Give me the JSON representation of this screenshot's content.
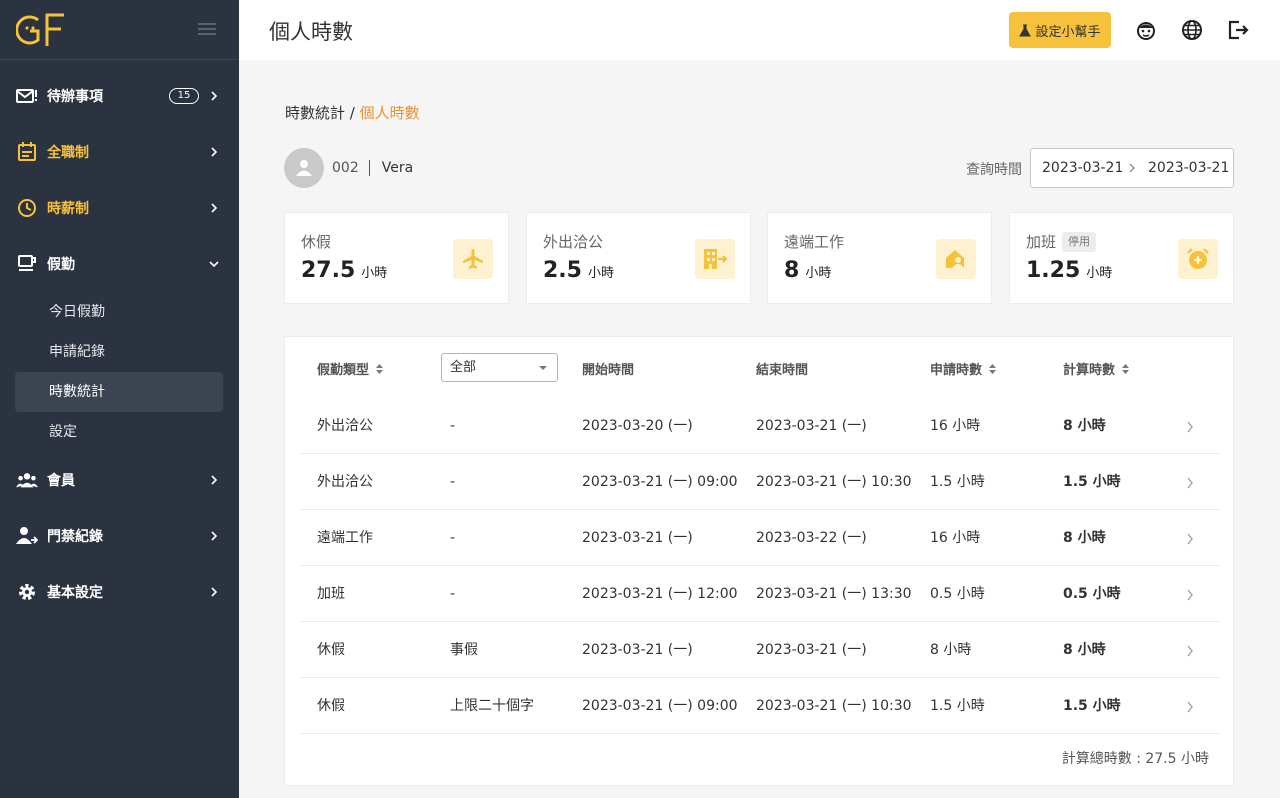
{
  "colors": {
    "accent": "#f6c13b",
    "sidebar_bg": "#2b3240",
    "breadcrumb_current": "#f08f2b",
    "icon_bg": "#fdf1cf"
  },
  "sidebar": {
    "logo_icon": "gf-logo-icon",
    "menu_icon": "hamburger-icon",
    "items": [
      {
        "label": "待辦事項",
        "icon": "mail-alert-icon",
        "badge": "15"
      },
      {
        "label": "全職制",
        "icon": "calendar-icon"
      },
      {
        "label": "時薪制",
        "icon": "clock-icon"
      },
      {
        "label": "假勤",
        "icon": "coffee-icon"
      },
      {
        "label": "會員",
        "icon": "users-icon"
      },
      {
        "label": "門禁紀錄",
        "icon": "user-access-icon"
      },
      {
        "label": "基本設定",
        "icon": "gear-icon"
      }
    ],
    "sub_items": [
      {
        "label": "今日假勤"
      },
      {
        "label": "申請紀錄"
      },
      {
        "label": "時數統計"
      },
      {
        "label": "設定"
      }
    ]
  },
  "header": {
    "title": "個人時數",
    "helper_button": "設定小幫手",
    "icons": [
      "emoji-icon",
      "globe-icon",
      "logout-icon"
    ]
  },
  "breadcrumb": {
    "parent": "時數統計",
    "separator": "/",
    "current": "個人時數"
  },
  "user": {
    "id": "002",
    "name": "Vera"
  },
  "query": {
    "label": "查詢時間",
    "start": "2023-03-21",
    "end": "2023-03-21"
  },
  "stats": [
    {
      "title": "休假",
      "value": "27.5",
      "unit": "小時",
      "icon": "airplane-icon"
    },
    {
      "title": "外出洽公",
      "value": "2.5",
      "unit": "小時",
      "icon": "building-exit-icon"
    },
    {
      "title": "遠端工作",
      "value": "8",
      "unit": "小時",
      "icon": "home-work-icon"
    },
    {
      "title": "加班",
      "tag": "停用",
      "value": "1.25",
      "unit": "小時",
      "icon": "alarm-plus-icon"
    }
  ],
  "table": {
    "headers": {
      "type": "假勤類型",
      "filter": "全部",
      "start": "開始時間",
      "end": "結束時間",
      "applied": "申請時數",
      "calculated": "計算時數"
    },
    "rows": [
      {
        "type": "外出洽公",
        "sub": "-",
        "start": "2023-03-20 (一)",
        "end": "2023-03-21 (一)",
        "applied": "16 小時",
        "calculated": "8 小時"
      },
      {
        "type": "外出洽公",
        "sub": "-",
        "start": "2023-03-21 (一)  09:00",
        "end": "2023-03-21 (一)  10:30",
        "applied": "1.5 小時",
        "calculated": "1.5 小時"
      },
      {
        "type": "遠端工作",
        "sub": "-",
        "start": "2023-03-21 (一)",
        "end": "2023-03-22 (一)",
        "applied": "16 小時",
        "calculated": "8 小時"
      },
      {
        "type": "加班",
        "sub": "-",
        "start": "2023-03-21 (一)  12:00",
        "end": "2023-03-21 (一)  13:30",
        "applied": "0.5 小時",
        "calculated": "0.5 小時"
      },
      {
        "type": "休假",
        "sub": "事假",
        "start": "2023-03-21 (一)",
        "end": "2023-03-21 (一)",
        "applied": "8 小時",
        "calculated": "8 小時"
      },
      {
        "type": "休假",
        "sub": "上限二十個字",
        "start": "2023-03-21 (一)  09:00",
        "end": "2023-03-21 (一)  10:30",
        "applied": "1.5 小時",
        "calculated": "1.5 小時"
      }
    ],
    "total": "計算總時數 : 27.5 小時"
  }
}
